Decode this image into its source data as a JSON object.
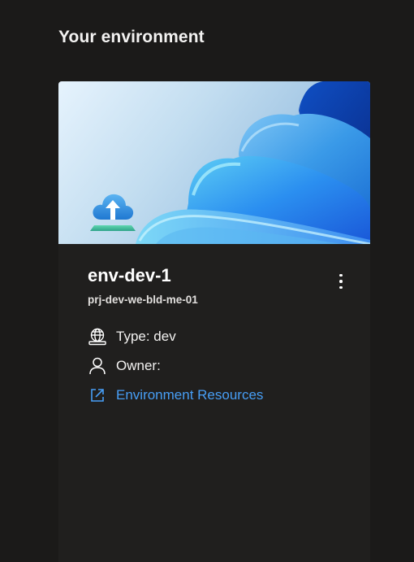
{
  "section": {
    "title": "Your environment"
  },
  "environment": {
    "name": "env-dev-1",
    "project": "prj-dev-we-bld-me-01",
    "type_label": "Type: dev",
    "owner_label": "Owner:",
    "resources_link": "Environment Resources"
  },
  "icons": {
    "more": "more-vertical-icon",
    "type": "globe-desktop-icon",
    "owner": "person-icon",
    "link": "open-external-icon",
    "environment": "cloud-upload-icon"
  },
  "colors": {
    "background": "#1b1a19",
    "card": "#201f1e",
    "link": "#479ef5",
    "text": "#ffffff"
  }
}
